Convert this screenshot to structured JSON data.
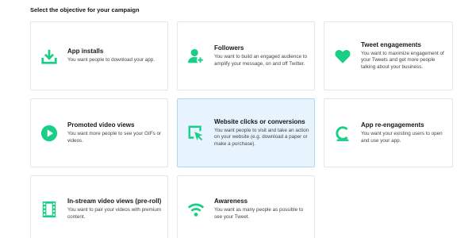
{
  "heading": "Select the objective for your campaign",
  "accent_color": "#19cf86",
  "selected_color": "#e8f4fd",
  "cards": [
    {
      "title": "App installs",
      "description": "You want people to download your app.",
      "icon": "download-icon"
    },
    {
      "title": "Followers",
      "description": "You want to build an engaged audience to amplify your message, on and off Twitter.",
      "icon": "add-user-icon"
    },
    {
      "title": "Tweet engagements",
      "description": "You want to maximize engagement of your Tweets and get more people talking about your business.",
      "icon": "heart-icon"
    },
    {
      "title": "Promoted video views",
      "description": "You want more people to see your GIFs or videos.",
      "icon": "play-icon"
    },
    {
      "title": "Website clicks or conversions",
      "description": "You want people to visit and take an action on your website (e.g. download a paper or make a purchase).",
      "icon": "cursor-click-icon",
      "selected": true
    },
    {
      "title": "App re-engagements",
      "description": "You want your existing users to open and use your app.",
      "icon": "reengage-icon"
    },
    {
      "title": "In-stream video views (pre-roll)",
      "description": "You want to pair your videos with premium content.",
      "icon": "film-icon"
    },
    {
      "title": "Awareness",
      "description": "You want as many people as possible to see your Tweet.",
      "icon": "broadcast-icon"
    }
  ]
}
